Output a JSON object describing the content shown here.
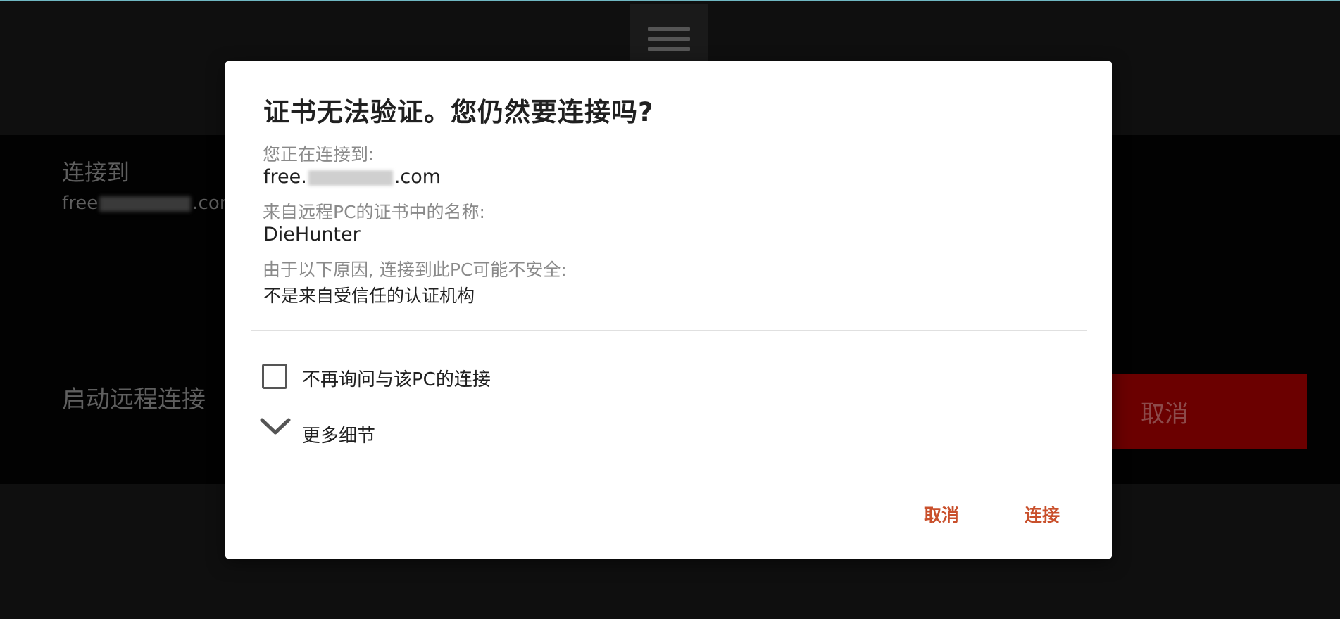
{
  "background": {
    "connect_to_label": "连接到",
    "host_prefix": "free",
    "host_suffix": ".com",
    "start_remote_label": "启动远程连接",
    "cancel_button_label": "取消"
  },
  "dialog": {
    "title": "证书无法验证。您仍然要连接吗?",
    "connecting_to_label": "您正在连接到:",
    "host_prefix": "free.",
    "host_suffix": ".com",
    "cert_name_label": "来自远程PC的证书中的名称:",
    "cert_name_value": "DieHunter",
    "unsafe_reason_label": "由于以下原因, 连接到此PC可能不安全:",
    "unsafe_reason_value": "不是来自受信任的认证机构",
    "dont_ask_label": "不再询问与该PC的连接",
    "dont_ask_checked": false,
    "more_details_label": "更多细节",
    "cancel_label": "取消",
    "connect_label": "连接"
  },
  "colors": {
    "accent": "#c9502c",
    "background_cancel": "#6b0000"
  },
  "icons": {
    "menu": "hamburger-menu-icon",
    "chevron": "chevron-down-icon"
  }
}
